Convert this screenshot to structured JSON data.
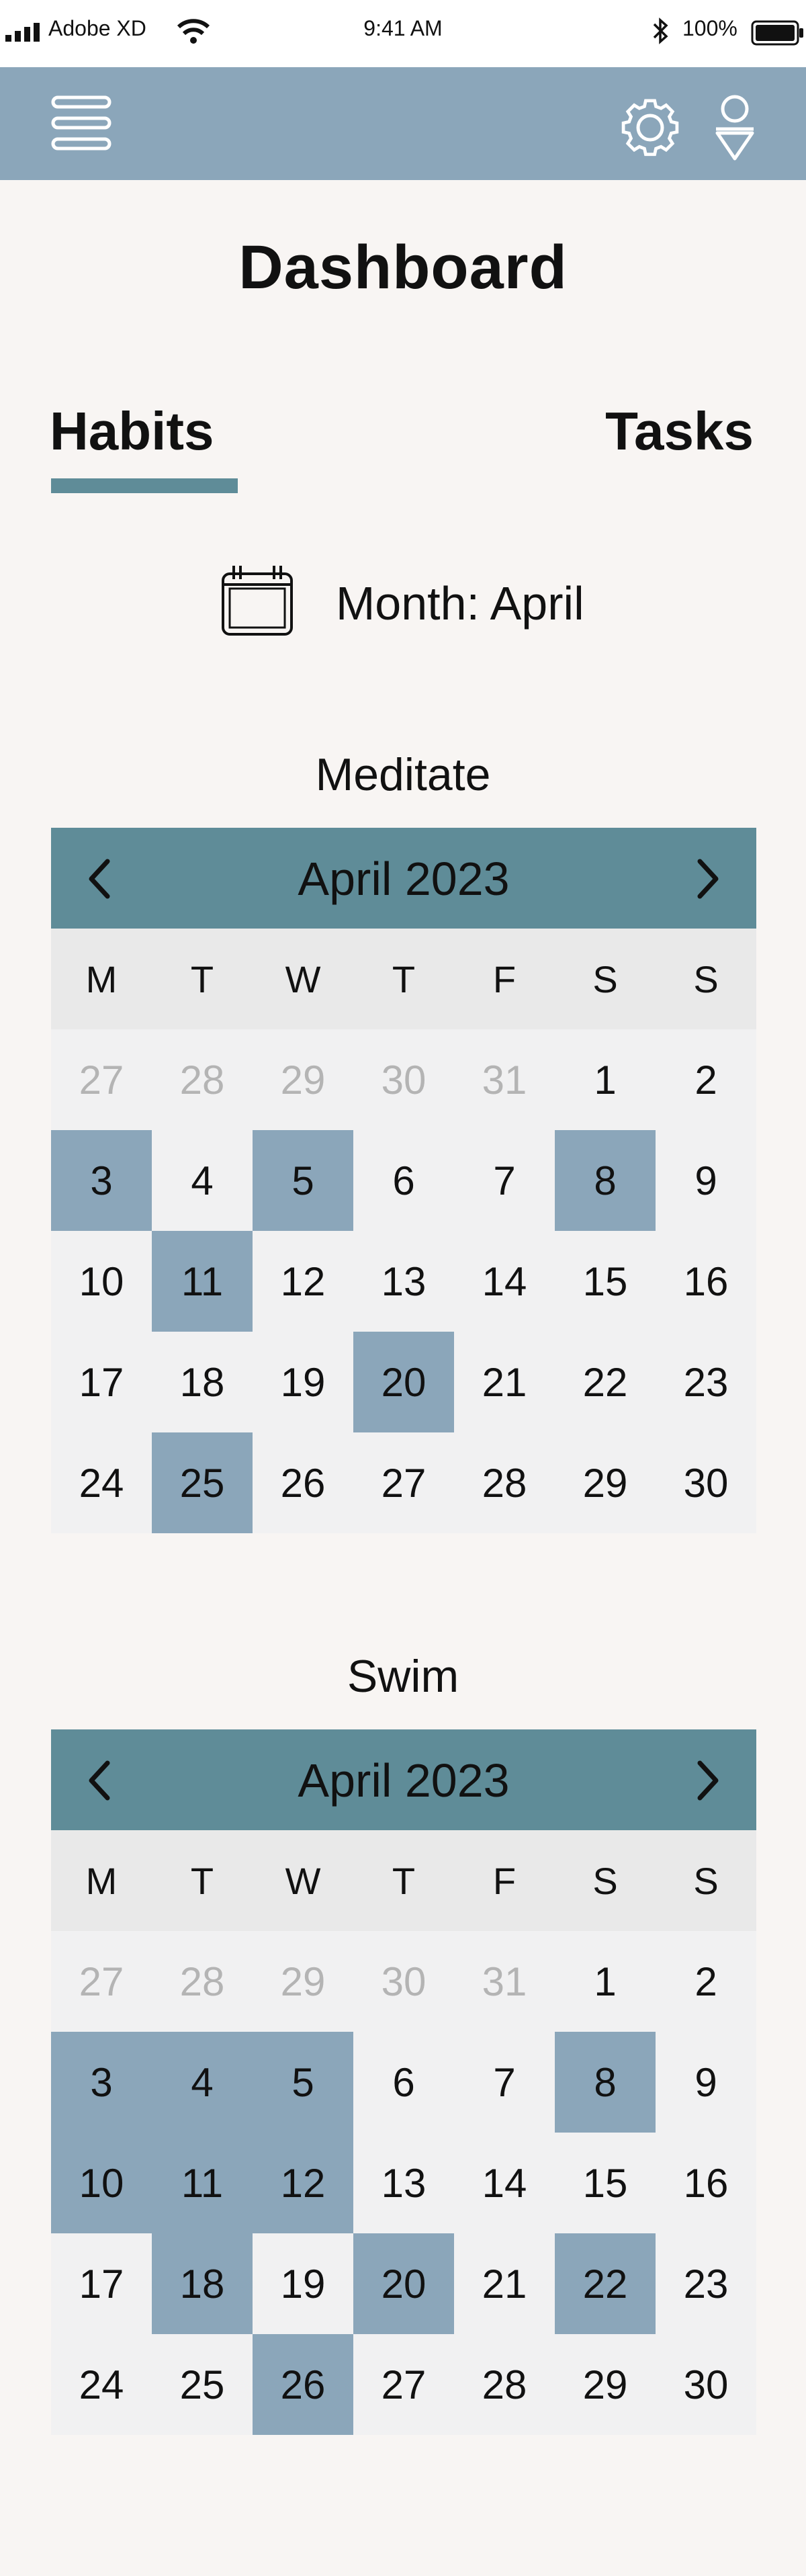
{
  "status_bar": {
    "carrier": "Adobe XD",
    "time": "9:41 AM",
    "battery": "100%"
  },
  "header": {
    "title": "Dashboard"
  },
  "tabs": [
    {
      "label": "Habits",
      "active": true
    },
    {
      "label": "Tasks",
      "active": false
    }
  ],
  "month_selector": {
    "label": "Month: April"
  },
  "colors": {
    "nav_bar": "#8ba6ba",
    "accent": "#5f8c98",
    "completed_day": "#8ba6ba",
    "background": "#f8f5f3"
  },
  "weekdays": [
    "M",
    "T",
    "W",
    "T",
    "F",
    "S",
    "S"
  ],
  "habits": [
    {
      "name": "Meditate",
      "calendar_month": "April 2023",
      "leading_days": [
        "27",
        "28",
        "29",
        "30",
        "31"
      ],
      "days_in_month": 30,
      "completed": [
        3,
        5,
        8,
        11,
        20,
        25
      ]
    },
    {
      "name": "Swim",
      "calendar_month": "April 2023",
      "leading_days": [
        "27",
        "28",
        "29",
        "30",
        "31"
      ],
      "days_in_month": 30,
      "completed": [
        3,
        4,
        5,
        8,
        10,
        11,
        12,
        18,
        20,
        22,
        26
      ]
    }
  ]
}
